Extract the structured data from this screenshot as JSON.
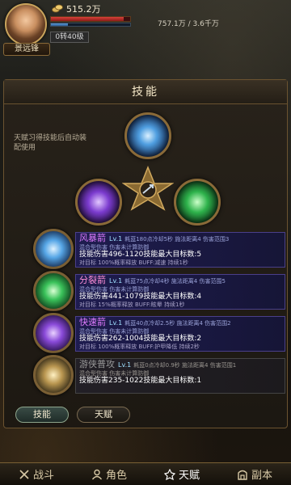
{
  "hud": {
    "player_name": "景远锋",
    "gold": "515.2万",
    "rebirth": "0转40级",
    "exp": "757.1万 / 3.6千万",
    "hp_fraction": 0.92,
    "mp_fraction": 0.21
  },
  "panel": {
    "title": "技能",
    "hint": "天赋习得技能后自动装配使用"
  },
  "skills": [
    {
      "name": "风暴箭",
      "level": "Lv.1",
      "range": "耗蓝180点冷却5秒 施法距离4 伤害范围3",
      "type": "混合型伤害 伤害未计算防御",
      "damage": "技能伤害496-1120技能最大目标数:5",
      "extra": "对目标 100%概率释放 BUFF:减速 持续1秒"
    },
    {
      "name": "分裂箭",
      "level": "Lv.1",
      "range": "耗蓝75点冷却4秒 施法距离4 伤害范围5",
      "type": "混合型伤害 伤害未计算防御",
      "damage": "技能伤害441-1079技能最大目标数:4",
      "extra": "对目标 15%概率释放 BUFF:眩晕 持续1秒"
    },
    {
      "name": "快速箭",
      "level": "Lv.1",
      "range": "耗蓝40点冷却2.5秒 施法距离4 伤害范围2",
      "type": "混合型伤害 伤害未计算防御",
      "damage": "技能伤害262-1004技能最大目标数:2",
      "extra": "对目标 100%概率释放 BUFF:护甲降低 持续2秒"
    },
    {
      "name": "游侠普攻",
      "level": "Lv.1",
      "range": "耗蓝0点冷却0.9秒 施法距离4 伤害范围1",
      "type": "混合型伤害 伤害未计算防御",
      "damage": "技能伤害235-1022技能最大目标数:1",
      "extra": ""
    }
  ],
  "tabs": {
    "skills": "技能",
    "talent": "天赋"
  },
  "nav": [
    {
      "label": "战斗",
      "icon": "swords-icon"
    },
    {
      "label": "角色",
      "icon": "character-icon"
    },
    {
      "label": "天赋",
      "icon": "talent-icon"
    },
    {
      "label": "副本",
      "icon": "dungeon-icon"
    }
  ],
  "colors": {
    "accent_gold": "#c9a45c",
    "skill_name_purple": "#e07cff",
    "hp": "#d8413a"
  }
}
